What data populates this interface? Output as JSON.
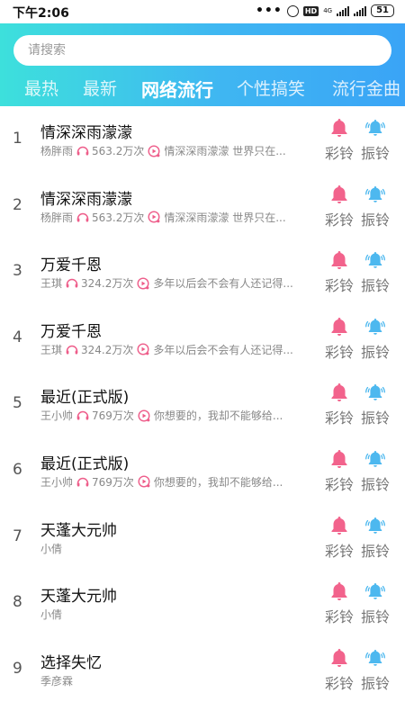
{
  "status": {
    "time": "下午2:06",
    "battery": "51",
    "hd": "HD",
    "net": "4G"
  },
  "search": {
    "placeholder": "请搜索"
  },
  "tabs": [
    "最热",
    "最新",
    "网络流行",
    "个性搞笑",
    "流行金曲"
  ],
  "active_tab": "网络流行",
  "actions": {
    "color_ring": "彩铃",
    "vibrate_ring": "振铃"
  },
  "colors": {
    "header_start": "#3de0dc",
    "header_end": "#3aa4f6",
    "color_ring_bell": "#f2638c",
    "vibrate_bell": "#4db8ef"
  },
  "songs": [
    {
      "index": "1",
      "title": "情深深雨濛濛",
      "artist": "杨胖雨",
      "plays": "563.2万次",
      "desc": "情深深雨濛濛 世界只在..."
    },
    {
      "index": "2",
      "title": "情深深雨濛濛",
      "artist": "杨胖雨",
      "plays": "563.2万次",
      "desc": "情深深雨濛濛 世界只在..."
    },
    {
      "index": "3",
      "title": "万爱千恩",
      "artist": "王琪",
      "plays": "324.2万次",
      "desc": "多年以后会不会有人还记得..."
    },
    {
      "index": "4",
      "title": "万爱千恩",
      "artist": "王琪",
      "plays": "324.2万次",
      "desc": "多年以后会不会有人还记得..."
    },
    {
      "index": "5",
      "title": "最近(正式版)",
      "artist": "王小帅",
      "plays": "769万次",
      "desc": "你想要的，我却不能够给..."
    },
    {
      "index": "6",
      "title": "最近(正式版)",
      "artist": "王小帅",
      "plays": "769万次",
      "desc": "你想要的，我却不能够给..."
    },
    {
      "index": "7",
      "title": "天蓬大元帅",
      "artist": "小倩"
    },
    {
      "index": "8",
      "title": "天蓬大元帅",
      "artist": "小倩"
    },
    {
      "index": "9",
      "title": "选择失忆",
      "artist": "季彦霖"
    }
  ]
}
